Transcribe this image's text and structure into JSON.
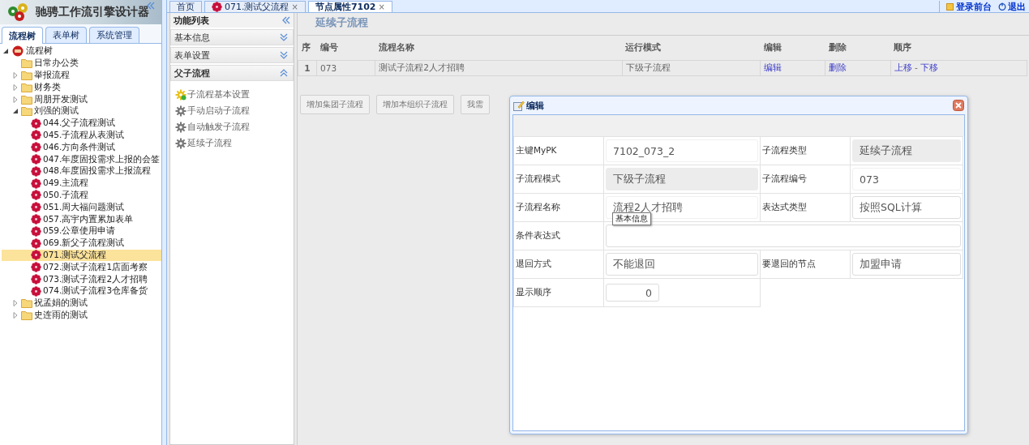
{
  "app": {
    "title": "驰骋工作流引擎设计器"
  },
  "left_tabs": [
    {
      "label": "流程树",
      "selected": true
    },
    {
      "label": "表单树",
      "selected": false
    },
    {
      "label": "系统管理",
      "selected": false
    }
  ],
  "tree": [
    {
      "label": "流程树",
      "kind": "root",
      "has_children": true,
      "expanded": true,
      "selected": false,
      "children": [
        {
          "label": "日常办公类",
          "kind": "folder",
          "has_children": false,
          "selected": false
        },
        {
          "label": "举报流程",
          "kind": "folder",
          "has_children": true,
          "expanded": false,
          "selected": false
        },
        {
          "label": "财务类",
          "kind": "folder",
          "has_children": true,
          "expanded": false,
          "selected": false
        },
        {
          "label": "周朋开发测试",
          "kind": "folder",
          "has_children": true,
          "expanded": false,
          "selected": false
        },
        {
          "label": "刘强的测试",
          "kind": "folder",
          "has_children": true,
          "expanded": true,
          "selected": false,
          "children": [
            {
              "label": "044.父子流程测试",
              "kind": "flow",
              "has_children": false,
              "selected": false
            },
            {
              "label": "045.子流程从表测试",
              "kind": "flow",
              "has_children": false,
              "selected": false
            },
            {
              "label": "046.方向条件测试",
              "kind": "flow",
              "has_children": false,
              "selected": false
            },
            {
              "label": "047.年度固投需求上报的会签",
              "kind": "flow",
              "has_children": false,
              "selected": false
            },
            {
              "label": "048.年度固投需求上报流程",
              "kind": "flow",
              "has_children": false,
              "selected": false
            },
            {
              "label": "049.主流程",
              "kind": "flow",
              "has_children": false,
              "selected": false
            },
            {
              "label": "050.子流程",
              "kind": "flow",
              "has_children": false,
              "selected": false
            },
            {
              "label": "051.周大福问题测试",
              "kind": "flow",
              "has_children": false,
              "selected": false
            },
            {
              "label": "057.高宇内置累加表单",
              "kind": "flow",
              "has_children": false,
              "selected": false
            },
            {
              "label": "059.公章使用申请",
              "kind": "flow",
              "has_children": false,
              "selected": false
            },
            {
              "label": "069.新父子流程测试",
              "kind": "flow",
              "has_children": false,
              "selected": false
            },
            {
              "label": "071.测试父流程",
              "kind": "flow",
              "has_children": false,
              "selected": true
            },
            {
              "label": "072.测试子流程1店面考察",
              "kind": "flow",
              "has_children": false,
              "selected": false
            },
            {
              "label": "073.测试子流程2人才招聘",
              "kind": "flow",
              "has_children": false,
              "selected": false
            },
            {
              "label": "074.测试子流程3仓库备货",
              "kind": "flow",
              "has_children": false,
              "selected": false
            }
          ]
        },
        {
          "label": "祝孟娟的测试",
          "kind": "folder",
          "has_children": true,
          "expanded": false,
          "selected": false
        },
        {
          "label": "史连雨的测试",
          "kind": "folder",
          "has_children": true,
          "expanded": false,
          "selected": false
        }
      ]
    }
  ],
  "main_tabs": [
    {
      "label": "首页",
      "kind": "plain",
      "closable": false,
      "selected": false
    },
    {
      "label": "071.测试父流程",
      "kind": "flow",
      "closable": true,
      "selected": false
    },
    {
      "label": "节点属性7102",
      "kind": "plain",
      "closable": true,
      "selected": true
    }
  ],
  "close_mark": "×",
  "top_links": [
    {
      "label": "登录前台",
      "kind": "login"
    },
    {
      "label": "退出",
      "kind": "logout"
    }
  ],
  "function_list": {
    "title": "功能列表",
    "sections": [
      {
        "label": "基本信息",
        "expanded": false
      },
      {
        "label": "表单设置",
        "expanded": false
      },
      {
        "label": "父子流程",
        "expanded": true,
        "items": [
          {
            "label": "子流程基本设置",
            "kind": "active"
          },
          {
            "label": "手动启动子流程",
            "kind": "plain"
          },
          {
            "label": "自动触发子流程",
            "kind": "plain"
          },
          {
            "label": "延续子流程",
            "kind": "plain"
          }
        ]
      }
    ]
  },
  "content": {
    "title": "延续子流程",
    "table": {
      "columns": [
        "序",
        "编号",
        "流程名称",
        "运行模式",
        "编辑",
        "删除",
        "顺序"
      ],
      "rows": [
        {
          "cells": [
            {
              "text": "1",
              "kind": "index"
            },
            {
              "text": "073",
              "kind": "text"
            },
            {
              "text": "测试子流程2人才招聘",
              "kind": "text"
            },
            {
              "text": "下级子流程",
              "kind": "text"
            },
            {
              "text": "编辑",
              "kind": "link"
            },
            {
              "text": "删除",
              "kind": "link"
            },
            {
              "kind": "order",
              "links": [
                "上移",
                "下移"
              ],
              "separator": "-"
            }
          ]
        }
      ]
    },
    "buttons": [
      "增加集团子流程",
      "增加本组织子流程",
      "我需"
    ]
  },
  "dialog": {
    "title": "编辑",
    "tooltip": "基本信息",
    "rows": [
      [
        {
          "label": "主键MyPK",
          "kind": "readonly",
          "value": "7102_073_2"
        },
        {
          "label": "子流程类型",
          "kind": "disabled",
          "value": "延续子流程"
        }
      ],
      [
        {
          "label": "子流程模式",
          "kind": "disabled",
          "value": "下级子流程"
        },
        {
          "label": "子流程编号",
          "kind": "readonly",
          "value": "073"
        }
      ],
      [
        {
          "label": "子流程名称",
          "kind": "readonly",
          "value": "流程2人才招聘"
        },
        {
          "label": "表达式类型",
          "kind": "select",
          "value": "按照SQL计算"
        }
      ],
      [
        {
          "label": "条件表达式",
          "kind": "wide"
        }
      ],
      [
        {
          "label": "退回方式",
          "kind": "select",
          "value": "不能退回"
        },
        {
          "label": "要退回的节点",
          "kind": "select",
          "value": "加盟申请"
        }
      ],
      [
        {
          "label": "显示顺序",
          "kind": "number",
          "value": "0"
        }
      ]
    ]
  }
}
